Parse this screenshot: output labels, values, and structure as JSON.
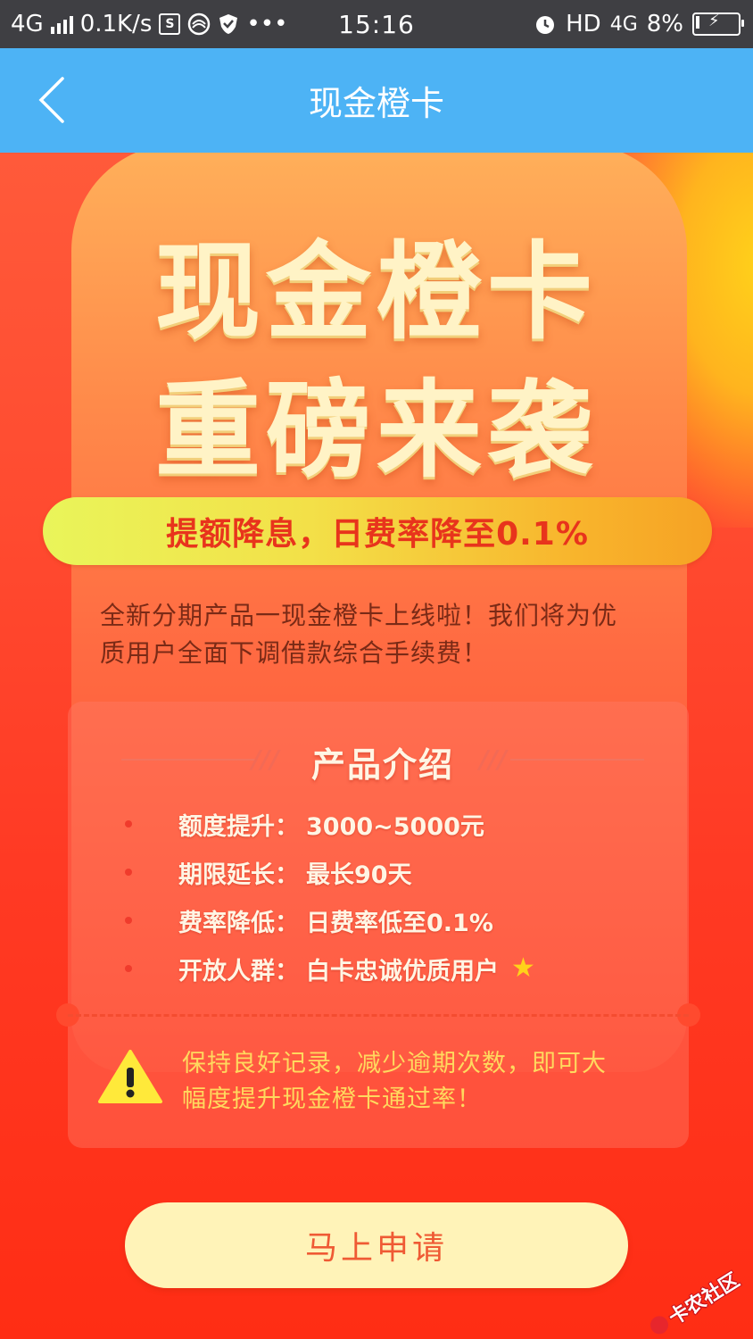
{
  "status_bar": {
    "network": "4G",
    "speed": "0.1K/s",
    "dots": "•••",
    "time": "15:16",
    "hd": "HD",
    "net_right": "4G",
    "battery": "8%"
  },
  "header": {
    "title": "现金橙卡"
  },
  "banner": {
    "hero_line1": "现金橙卡",
    "hero_line2": "重磅来袭",
    "pill_text": "提额降息，日费率降至0.1%",
    "intro_line1": "全新分期产品一现金橙卡上线啦！我们将为优",
    "intro_line2": "质用户全面下调借款综合手续费！"
  },
  "card": {
    "title": "产品介绍",
    "slashes": "///",
    "features": [
      {
        "label": "额度提升：",
        "value": "3000~5000元"
      },
      {
        "label": "期限延长：",
        "value": "最长90天"
      },
      {
        "label": "费率降低：",
        "value": "日费率低至0.1%"
      },
      {
        "label": "开放人群：",
        "value": "白卡忠诚优质用户"
      }
    ],
    "warning_line1": "保持良好记录，减少逾期次数，即可大",
    "warning_line2": "幅度提升现金橙卡通过率！"
  },
  "apply": {
    "label": "马上申请"
  },
  "watermark": {
    "text": "卡农社区"
  },
  "colors": {
    "header_bg": "#4db3f5",
    "main_red": "#ff3a1e",
    "pill_text": "#e8341c",
    "warning_text": "#ffd95e",
    "button_bg": "#fff3b8",
    "button_text": "#ef5a34"
  }
}
